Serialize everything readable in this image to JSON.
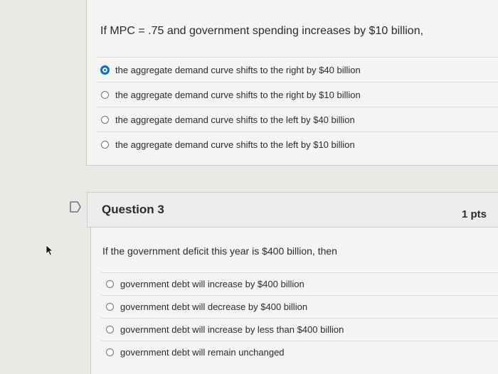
{
  "question2": {
    "text": "If MPC = .75 and government spending increases by $10 billion,",
    "answers": [
      {
        "label": "the aggregate demand curve shifts to the right by $40 billion",
        "selected": true
      },
      {
        "label": "the aggregate demand curve shifts to the right by $10 billion",
        "selected": false
      },
      {
        "label": "the aggregate demand curve shifts to the left by $40 billion",
        "selected": false
      },
      {
        "label": "the aggregate demand curve shifts to the left by $10 billion",
        "selected": false
      }
    ]
  },
  "question3": {
    "title": "Question 3",
    "points": "1 pts",
    "text": "If the government deficit this year is $400 billion, then",
    "answers": [
      {
        "label": "government debt will increase by $400 billion",
        "selected": false
      },
      {
        "label": "government debt will decrease by $400 billion",
        "selected": false
      },
      {
        "label": "government debt will increase by less than $400 billion",
        "selected": false
      },
      {
        "label": "government debt will remain unchanged",
        "selected": false
      }
    ]
  },
  "icons": {
    "flag": "flag-question-icon",
    "cursor": "mouse-pointer-icon"
  },
  "colors": {
    "selected_radio": "#0b6ec6",
    "background": "#e9e9e6",
    "card": "#f4f4f2"
  }
}
